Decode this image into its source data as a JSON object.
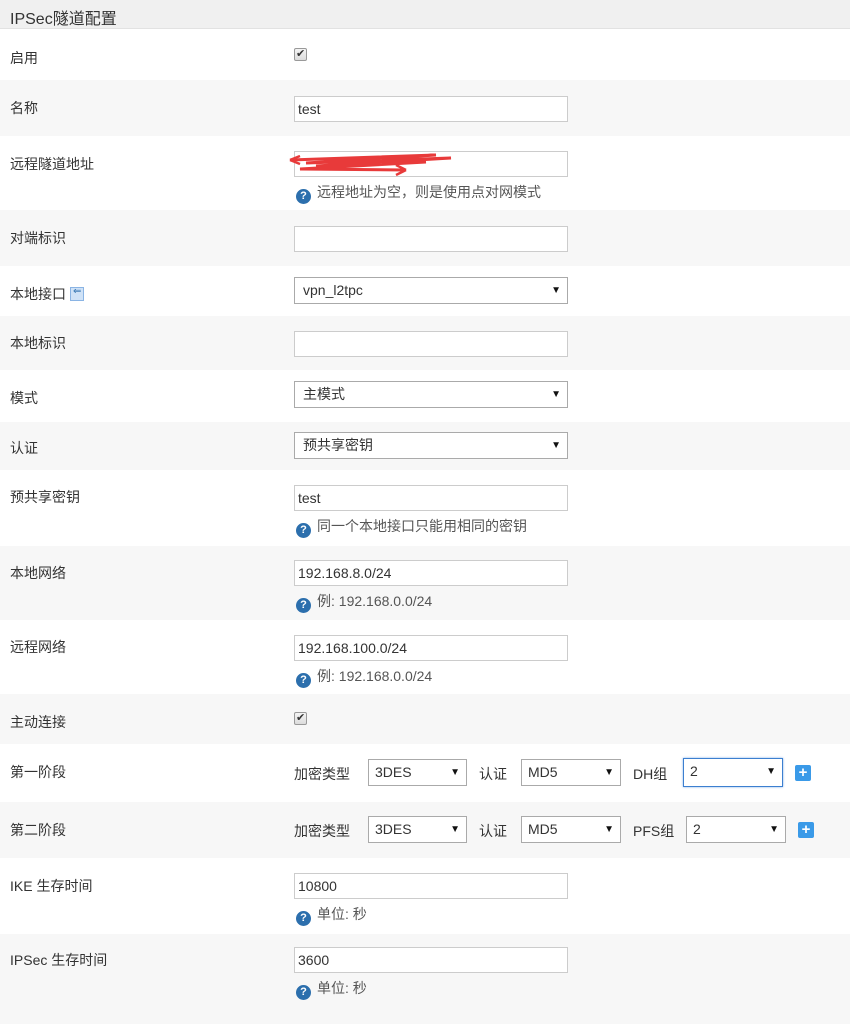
{
  "header": {
    "title": "IPSec隧道配置"
  },
  "fields": {
    "enable": {
      "label": "启用",
      "checked": true
    },
    "name": {
      "label": "名称",
      "value": "test"
    },
    "remote_address": {
      "label": "远程隧道地址",
      "help": "远程地址为空，则是使用点对网模式"
    },
    "peer_id": {
      "label": "对端标识",
      "value": ""
    },
    "local_interface": {
      "label": "本地接口",
      "value": "vpn_l2tpc",
      "icon": "interface-icon"
    },
    "local_id": {
      "label": "本地标识",
      "value": ""
    },
    "mode": {
      "label": "模式",
      "value": "主模式"
    },
    "auth": {
      "label": "认证",
      "value": "预共享密钥"
    },
    "psk": {
      "label": "预共享密钥",
      "value": "test",
      "help": "同一个本地接口只能用相同的密钥"
    },
    "local_network": {
      "label": "本地网络",
      "value": "192.168.8.0/24",
      "help": "例: 192.168.0.0/24"
    },
    "remote_network": {
      "label": "远程网络",
      "value": "192.168.100.0/24",
      "help": "例: 192.168.0.0/24"
    },
    "auto_connect": {
      "label": "主动连接",
      "checked": true
    },
    "phase1": {
      "label": "第一阶段",
      "enc_label": "加密类型",
      "enc_value": "3DES",
      "auth_label": "认证",
      "auth_value": "MD5",
      "group_label": "DH组",
      "group_value": "2"
    },
    "phase2": {
      "label": "第二阶段",
      "enc_label": "加密类型",
      "enc_value": "3DES",
      "auth_label": "认证",
      "auth_value": "MD5",
      "group_label": "PFS组",
      "group_value": "2"
    },
    "ike_lifetime": {
      "label": "IKE 生存时间",
      "value": "10800",
      "help": "单位: 秒"
    },
    "ipsec_lifetime": {
      "label": "IPSec 生存时间",
      "value": "3600",
      "help": "单位: 秒"
    }
  },
  "icons": {
    "help": "question-circle-icon",
    "add": "plus-icon",
    "dropdown": "caret-down-icon"
  },
  "colors": {
    "header_bg": "#f0f0f0",
    "row_alt_bg": "#f7f7f7",
    "help_icon": "#2c6fad",
    "add_button": "#3a9ae8",
    "redaction": "#e83a3a"
  }
}
